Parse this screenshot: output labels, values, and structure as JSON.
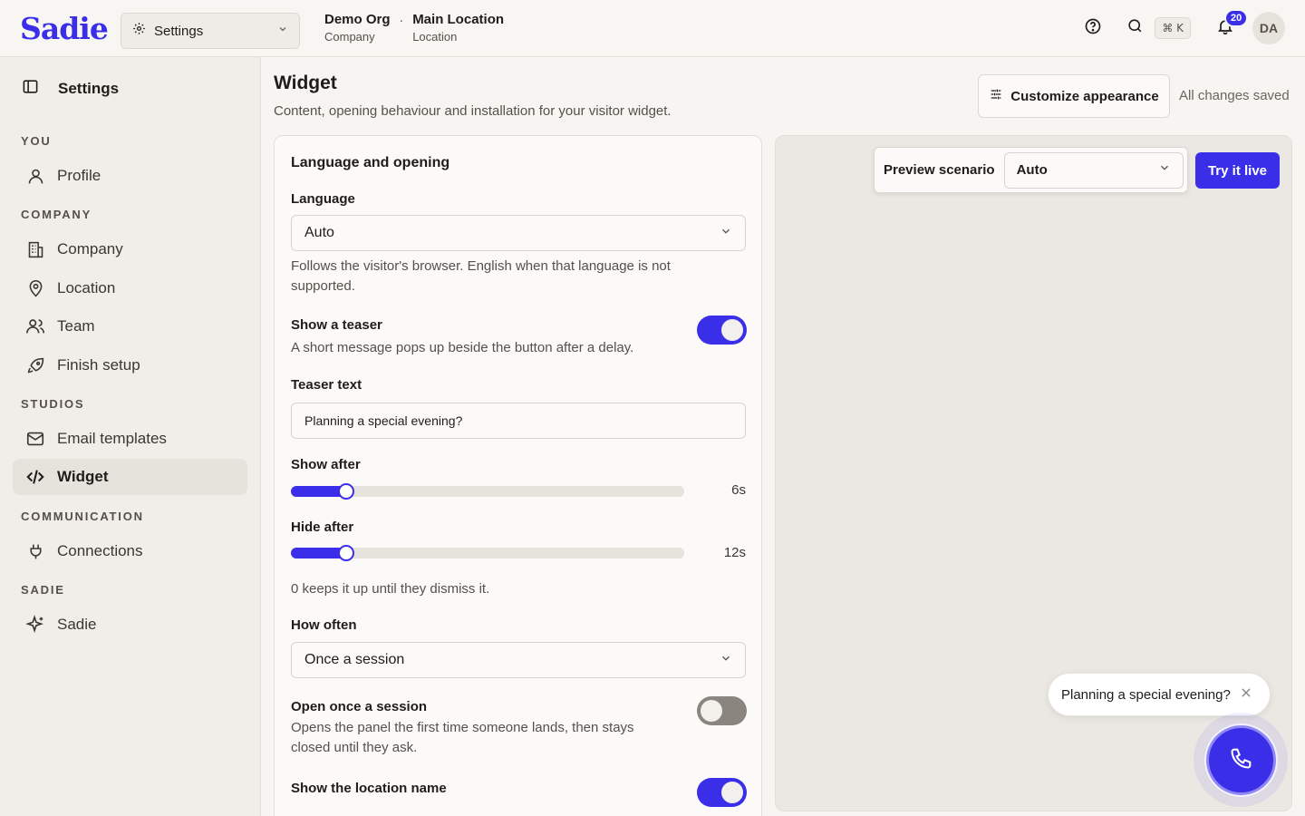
{
  "app": {
    "logo": "Sadie"
  },
  "header": {
    "context_select": "Settings",
    "org": {
      "name": "Demo Org",
      "type": "Company"
    },
    "separator": "·",
    "location": {
      "name": "Main Location",
      "type": "Location"
    },
    "shortcut": "⌘ K",
    "notification_count": "20",
    "avatar_initials": "DA"
  },
  "sidebar": {
    "title": "Settings",
    "sections": {
      "you": "YOU",
      "company": "COMPANY",
      "studios": "STUDIOS",
      "communication": "COMMUNICATION",
      "sadie": "SADIE"
    },
    "items": {
      "profile": "Profile",
      "company": "Company",
      "location": "Location",
      "team": "Team",
      "finish_setup": "Finish setup",
      "email_templates": "Email templates",
      "widget": "Widget",
      "connections": "Connections",
      "sadie": "Sadie"
    },
    "active": "widget"
  },
  "page": {
    "title": "Widget",
    "subtitle": "Content, opening behaviour and installation for your visitor widget.",
    "customize_button": "Customize appearance",
    "save_status": "All changes saved"
  },
  "form": {
    "section_title": "Language and opening",
    "language": {
      "label": "Language",
      "value": "Auto",
      "help": "Follows the visitor's browser. English when that language is not supported."
    },
    "show_teaser": {
      "label": "Show a teaser",
      "help": "A short message pops up beside the button after a delay.",
      "enabled": true
    },
    "teaser_text": {
      "label": "Teaser text",
      "value": "Planning a special evening?"
    },
    "show_after": {
      "label": "Show after",
      "value_text": "6s",
      "fill_fraction": 0.12
    },
    "hide_after": {
      "label": "Hide after",
      "value_text": "12s",
      "fill_fraction": 0.12
    },
    "hide_help": "0 keeps it up until they dismiss it.",
    "how_often": {
      "label": "How often",
      "value": "Once a session"
    },
    "open_once": {
      "label": "Open once a session",
      "help": "Opens the panel the first time someone lands, then stays closed until they ask.",
      "enabled": false
    },
    "show_location": {
      "label": "Show the location name",
      "enabled": true
    }
  },
  "preview": {
    "scenario_label": "Preview scenario",
    "scenario_value": "Auto",
    "try_button": "Try it live",
    "teaser_text": "Planning a special evening?"
  },
  "colors": {
    "accent": "#3a2ee8",
    "background": "#f7f5f1",
    "sidebar": "#f1eee9",
    "preview_bg": "#ebe8e3",
    "toggle_off": "#8a857e"
  },
  "icons": {
    "context": "gear-icon",
    "help": "help-circle-icon",
    "search": "search-icon",
    "notifications": "bell-icon",
    "sidebar_toggle": "sidebar-panel-icon",
    "profile": "user-icon",
    "company": "building-icon",
    "location": "map-pin-icon",
    "team": "users-icon",
    "finish_setup": "rocket-icon",
    "email_templates": "mail-icon",
    "widget": "code-icon",
    "connections": "plug-icon",
    "sadie": "sparkle-icon",
    "customize": "sliders-icon",
    "teaser_close": "close-icon",
    "call": "phone-icon"
  }
}
